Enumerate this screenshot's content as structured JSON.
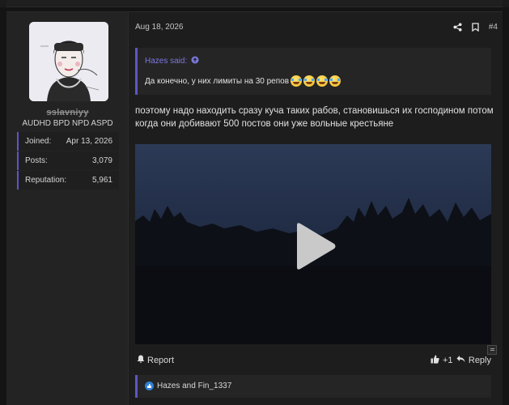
{
  "post": {
    "date": "Aug 18, 2026",
    "number": "#4",
    "message": "поэтому надо находить сразу куча таких рабов, становишься их господином потом когда они добивают 500 постов они уже вольные крестьяне"
  },
  "user": {
    "username": "sslavniyy",
    "title": "AUDHD BPD NPD ASPD",
    "stats": [
      {
        "label": "Joined:",
        "value": "Apr 13, 2026"
      },
      {
        "label": "Posts:",
        "value": "3,079"
      },
      {
        "label": "Reputation:",
        "value": "5,961"
      }
    ]
  },
  "quote": {
    "author": "Hazes said:",
    "text": "Да конечно, у них лимиты на 30 репов",
    "emoji": [
      "rolling-laughing-emoji",
      "rolling-laughing-emoji",
      "rolling-laughing-emoji",
      "rolling-laughing-emoji"
    ]
  },
  "footer": {
    "report_label": "Report",
    "react_label": "+1",
    "reply_label": "Reply"
  },
  "reactions": {
    "text": "Hazes and Fin_1337"
  },
  "colors": {
    "accent": "#5b57c7",
    "link": "#7c78e0",
    "background": "#1d1d1d"
  }
}
